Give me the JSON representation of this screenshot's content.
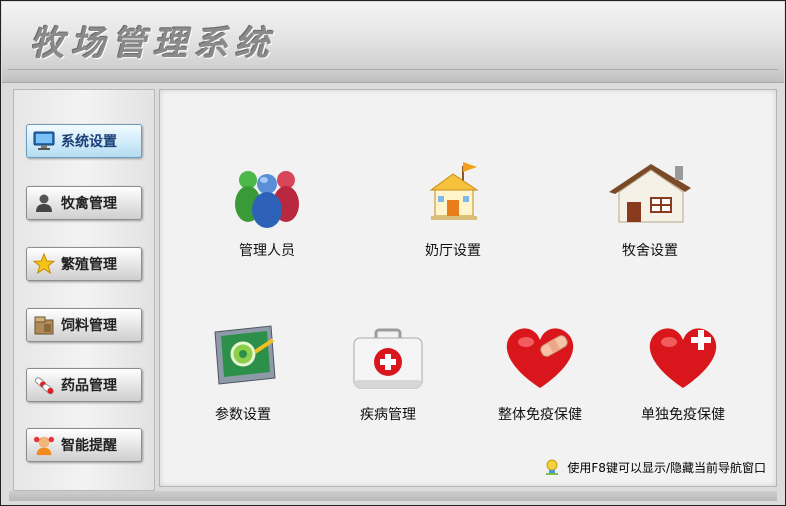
{
  "header": {
    "title": "牧场管理系统"
  },
  "sidebar": {
    "items": [
      {
        "label": "系统设置",
        "icon": "monitor-icon",
        "active": true
      },
      {
        "label": "牧禽管理",
        "icon": "user-icon"
      },
      {
        "label": "繁殖管理",
        "icon": "star-icon"
      },
      {
        "label": "饲料管理",
        "icon": "feed-box-icon"
      },
      {
        "label": "药品管理",
        "icon": "pills-icon"
      },
      {
        "label": "智能提醒",
        "icon": "reminder-icon"
      }
    ]
  },
  "main": {
    "tiles": [
      {
        "label": "管理人员",
        "icon": "people-icon"
      },
      {
        "label": "奶厅设置",
        "icon": "milk-hall-icon"
      },
      {
        "label": "牧舍设置",
        "icon": "house-icon"
      },
      {
        "label": "参数设置",
        "icon": "settings-panel-icon"
      },
      {
        "label": "疾病管理",
        "icon": "first-aid-kit-icon"
      },
      {
        "label": "整体免疫保健",
        "icon": "heart-bandage-icon"
      },
      {
        "label": "单独免疫保健",
        "icon": "heart-plus-icon"
      }
    ],
    "hint": "使用F8键可以显示/隐藏当前导航窗口"
  },
  "colors": {
    "active_nav": "#cde9f8",
    "accent_red": "#d8161b"
  }
}
